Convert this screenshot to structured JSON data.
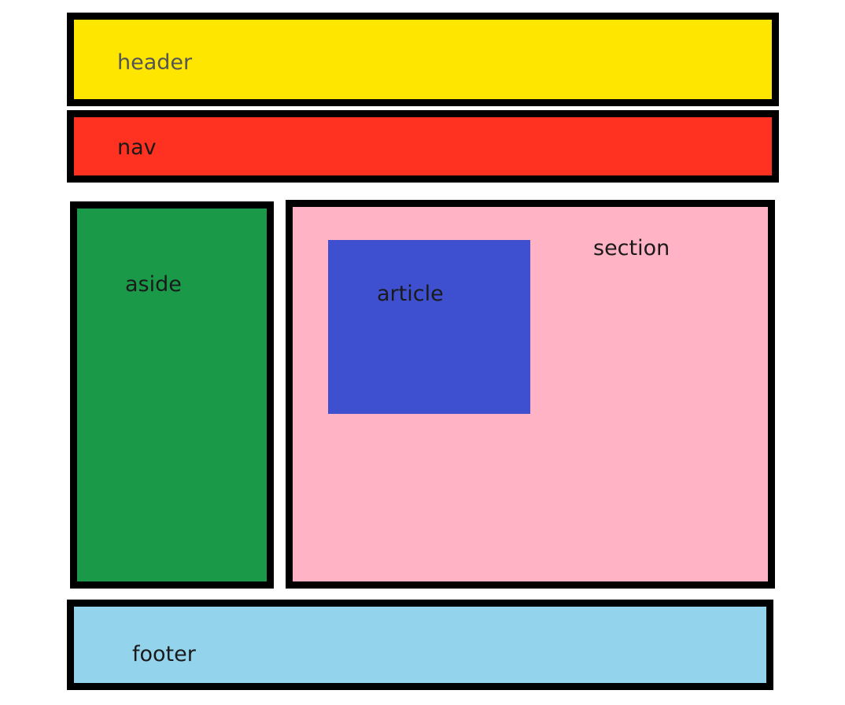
{
  "colors": {
    "header": "#FFE600",
    "nav": "#FF3120",
    "aside": "#1A9A48",
    "section": "#FFB3C5",
    "article": "#3E50CF",
    "footer": "#94D3EC",
    "border": "#000000"
  },
  "regions": {
    "header": {
      "label": "header"
    },
    "nav": {
      "label": "nav"
    },
    "aside": {
      "label": "aside"
    },
    "section": {
      "label": "section"
    },
    "article": {
      "label": "article"
    },
    "footer": {
      "label": "footer"
    }
  }
}
